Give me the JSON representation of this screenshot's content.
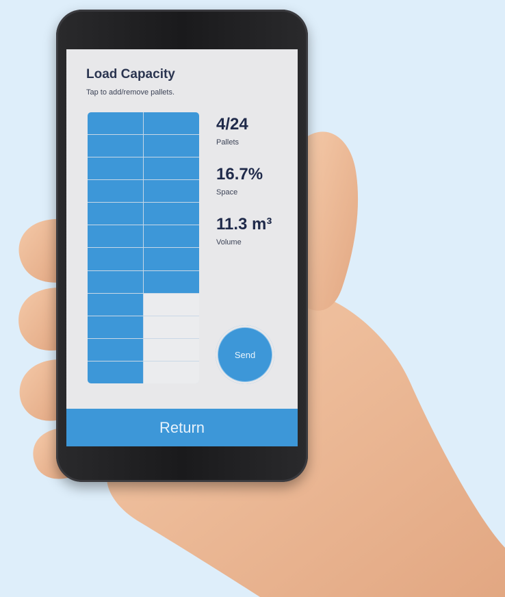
{
  "app": {
    "title": "Load Capacity",
    "subtitle": "Tap to add/remove pallets."
  },
  "pallet_grid": {
    "columns": 2,
    "rows": 12,
    "filled_cells": 20,
    "total_cells": 24,
    "fill_color": "#3d97d8",
    "empty_color": "#ebecee"
  },
  "stats": {
    "pallets_value": "4/24",
    "pallets_label": "Pallets",
    "space_value": "16.7%",
    "space_label": "Space",
    "volume_value": "11.3 m³",
    "volume_label": "Volume"
  },
  "actions": {
    "send_label": "Send",
    "return_label": "Return"
  },
  "colors": {
    "accent": "#3d97d8",
    "background": "#deeefa",
    "text_dark": "#1f2a4a"
  }
}
